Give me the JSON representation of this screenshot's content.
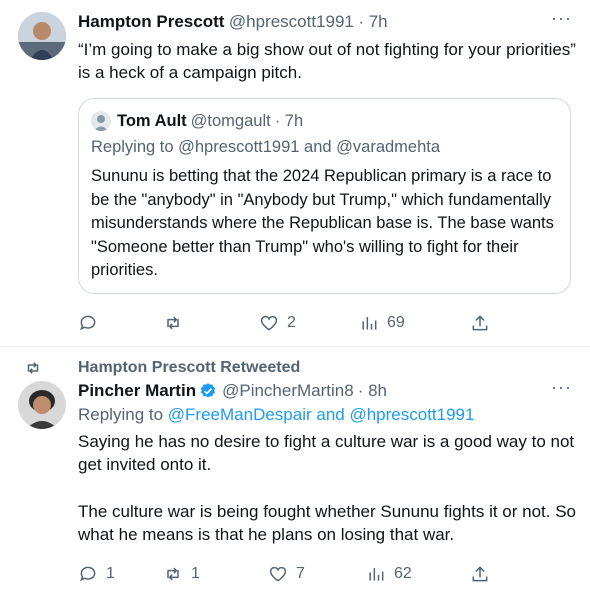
{
  "tweet1": {
    "author_name": "Hampton Prescott",
    "handle": "@hprescott1991",
    "time": "· 7h",
    "text": "“I’m going to make a big show out of not fighting for your priorities” is a heck of a campaign pitch.",
    "quote": {
      "author_name": "Tom Ault",
      "handle": "@tomgault",
      "time": "· 7h",
      "replying_to": "Replying to @hprescott1991 and @varadmehta",
      "text": "Sununu is betting that the 2024 Republican primary is a race to be the \"anybody\" in \"Anybody but Trump,\" which fundamentally misunderstands where the Republican base is.  The base wants \"Someone better than Trump\" who's willing to fight for their priorities."
    },
    "actions": {
      "reply_count": "",
      "retweet_count": "",
      "like_count": "2",
      "view_count": "69"
    }
  },
  "tweet2": {
    "retweeted_by": "Hampton Prescott Retweeted",
    "author_name": "Pincher Martin",
    "handle": "@PincherMartin8",
    "time": "· 8h",
    "replying_prefix": "Replying to ",
    "replying_to": "@FreeManDespair and @hprescott1991",
    "text_p1": "Saying he has no desire to fight a culture war is a good way to not get invited onto it.",
    "text_p2": "The culture war is being fought whether Sununu fights it or not.  So what he means is that he plans on losing that war.",
    "actions": {
      "reply_count": "1",
      "retweet_count": "1",
      "like_count": "7",
      "view_count": "62"
    }
  },
  "colors": {
    "accent": "#1d9bf0",
    "secondary_text": "#536471",
    "verified": "#1d9bf0"
  }
}
